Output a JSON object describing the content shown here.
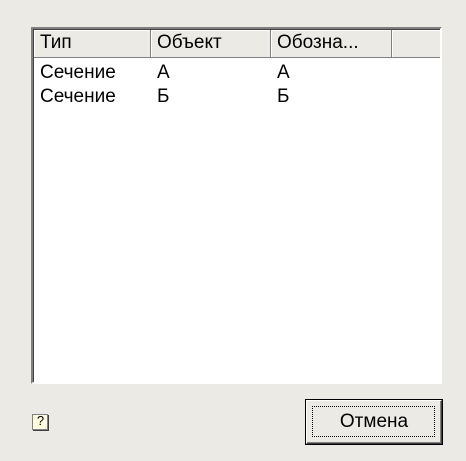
{
  "list": {
    "columns": [
      {
        "label": "Тип"
      },
      {
        "label": "Объект"
      },
      {
        "label": "Обозна..."
      }
    ],
    "rows": [
      [
        "Сечение",
        "А",
        "А"
      ],
      [
        "Сечение",
        "Б",
        "Б"
      ]
    ]
  },
  "help": {
    "icon": "help-question-icon",
    "glyph": "?"
  },
  "buttons": {
    "cancel_label": "Отмена"
  }
}
